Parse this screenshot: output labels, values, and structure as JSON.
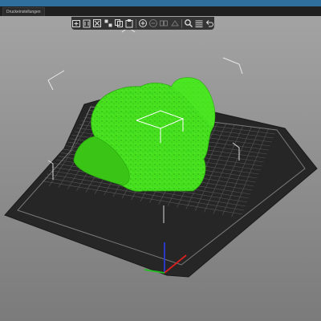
{
  "window": {
    "tab_label": "Druckeinstellungen"
  },
  "toolbar": {
    "buttons": [
      {
        "icon": "add-object-icon"
      },
      {
        "icon": "delete-icon"
      },
      {
        "icon": "delete-all-icon"
      },
      {
        "icon": "arrange-icon"
      },
      {
        "icon": "copy-icon"
      },
      {
        "icon": "paste-icon"
      },
      {
        "icon": "add-instance-icon"
      },
      {
        "icon": "remove-instance-icon"
      },
      {
        "icon": "split-objects-icon"
      },
      {
        "icon": "split-parts-icon"
      },
      {
        "icon": "search-icon"
      },
      {
        "icon": "layers-icon"
      },
      {
        "icon": "undo-icon"
      }
    ]
  },
  "colors": {
    "model": "#3fd61a",
    "bed": "#262626",
    "grid": "#5a5a5a",
    "background": "#8a8a8a",
    "accent": "#2f6f9e"
  }
}
